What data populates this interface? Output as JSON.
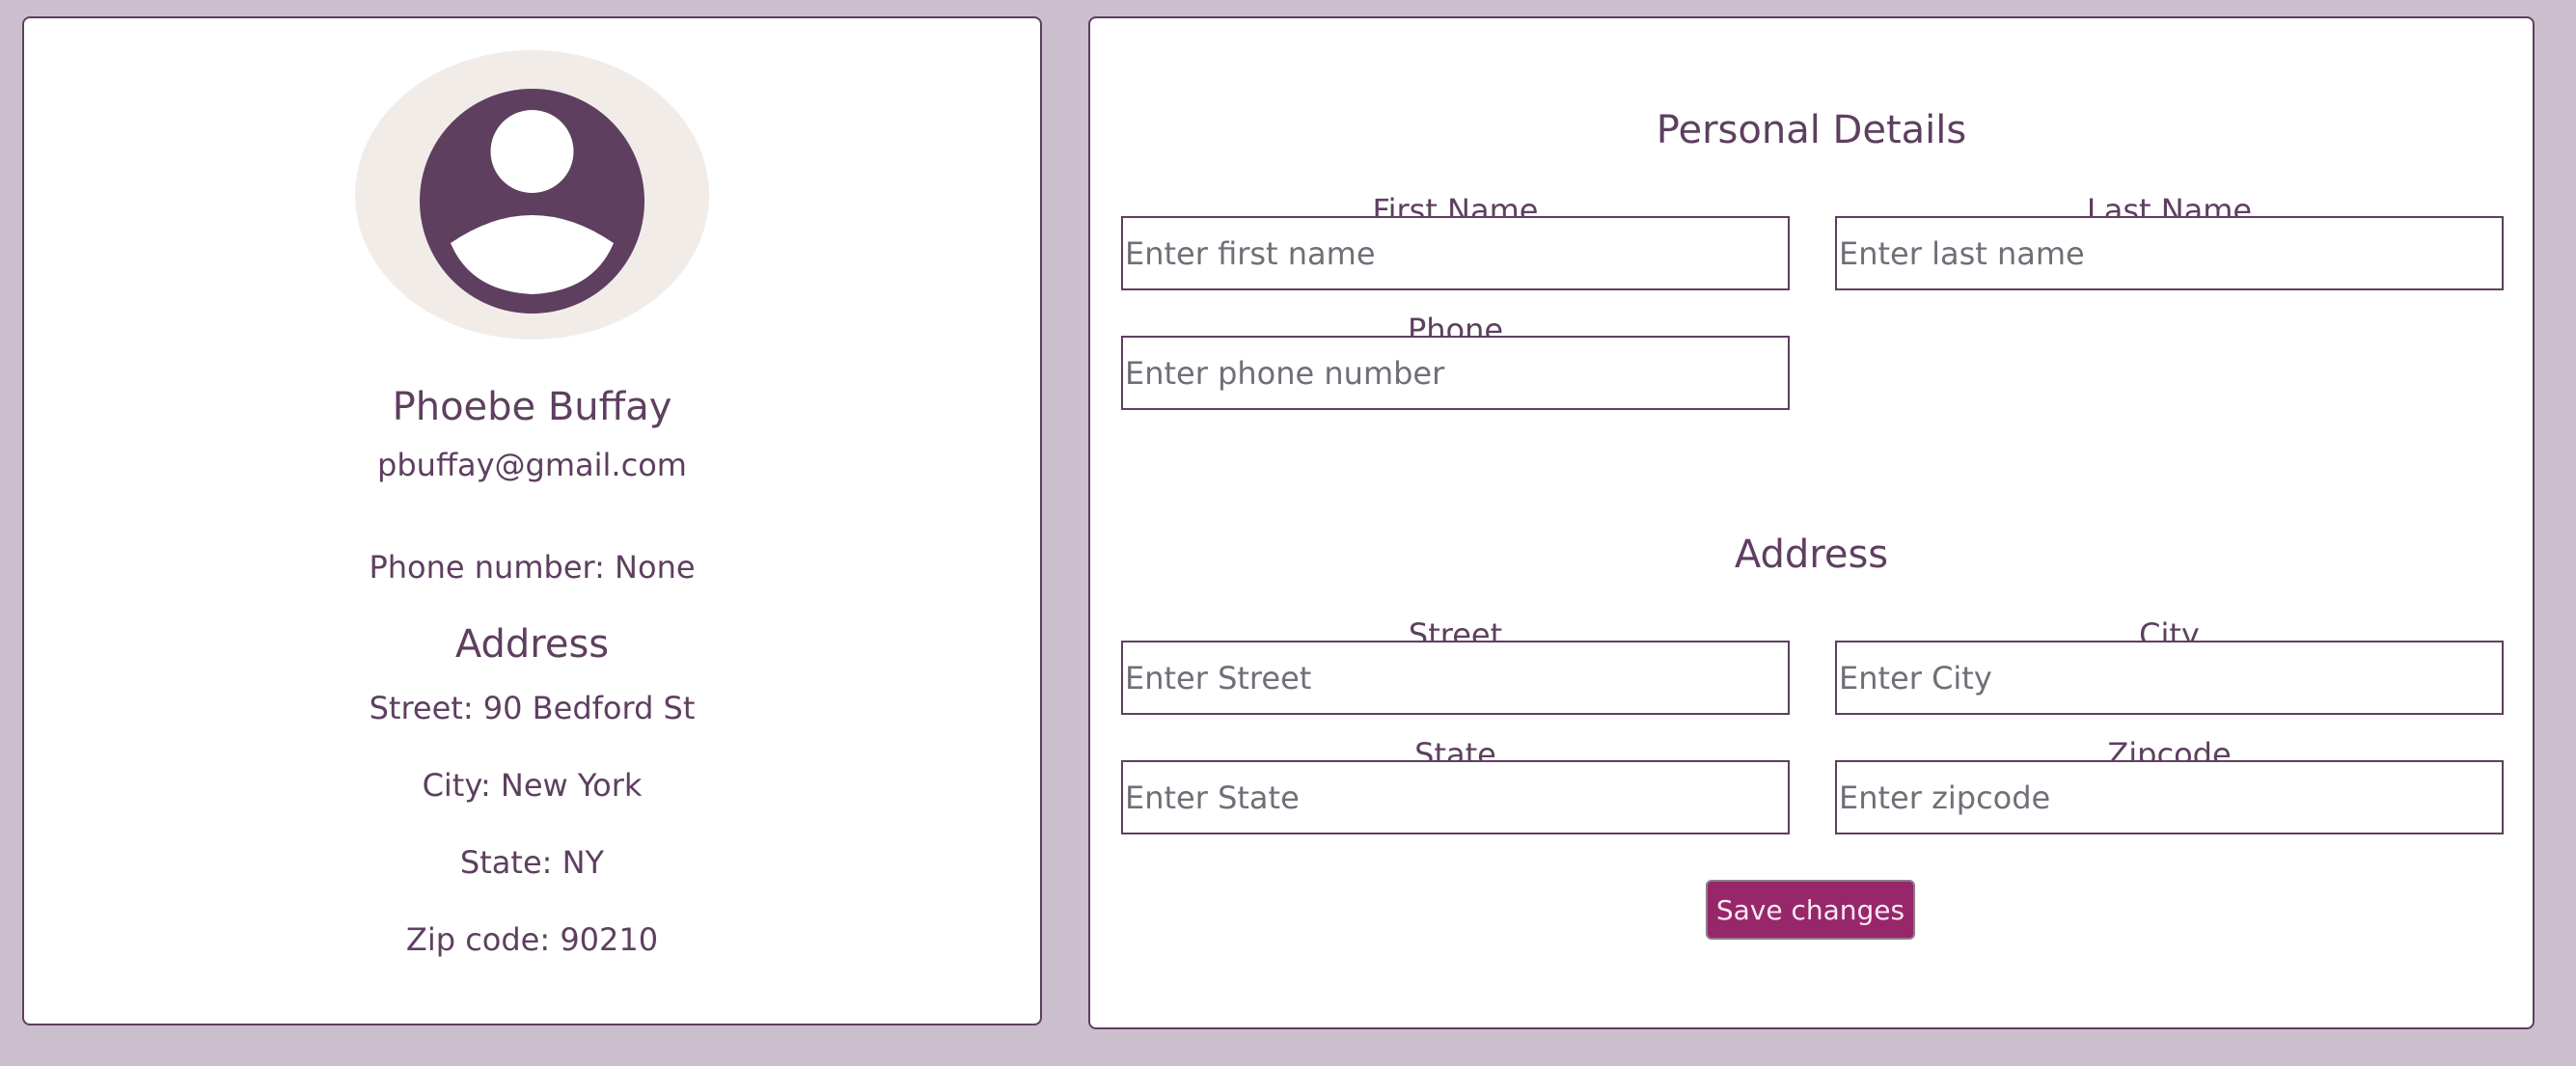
{
  "colors": {
    "page_background": "#cbbfce",
    "card_background": "#ffffff",
    "text": "#5e3f60",
    "avatar_background": "#f1ece8",
    "accent_button": "#98266a"
  },
  "profile": {
    "avatar_icon": "user-avatar-icon",
    "name": "Phoebe Buffay",
    "email": "pbuffay@gmail.com",
    "phone": "Phone number: None",
    "address_title": "Address",
    "street": "Street: 90 Bedford St",
    "city": "City: New York",
    "state": "State: NY",
    "zip": "Zip code: 90210"
  },
  "form": {
    "personal_title": "Personal Details",
    "first_name": {
      "label": "First Name",
      "placeholder": "Enter first name",
      "value": ""
    },
    "last_name": {
      "label": "Last Name",
      "placeholder": "Enter last name",
      "value": ""
    },
    "phone": {
      "label": "Phone",
      "placeholder": "Enter phone number",
      "value": ""
    },
    "address_title": "Address",
    "street": {
      "label": "Street",
      "placeholder": "Enter Street",
      "value": ""
    },
    "city": {
      "label": "City",
      "placeholder": "Enter City",
      "value": ""
    },
    "state": {
      "label": "State",
      "placeholder": "Enter State",
      "value": ""
    },
    "zipcode": {
      "label": "Zipcode",
      "placeholder": "Enter zipcode",
      "value": ""
    },
    "save_label": "Save changes"
  }
}
